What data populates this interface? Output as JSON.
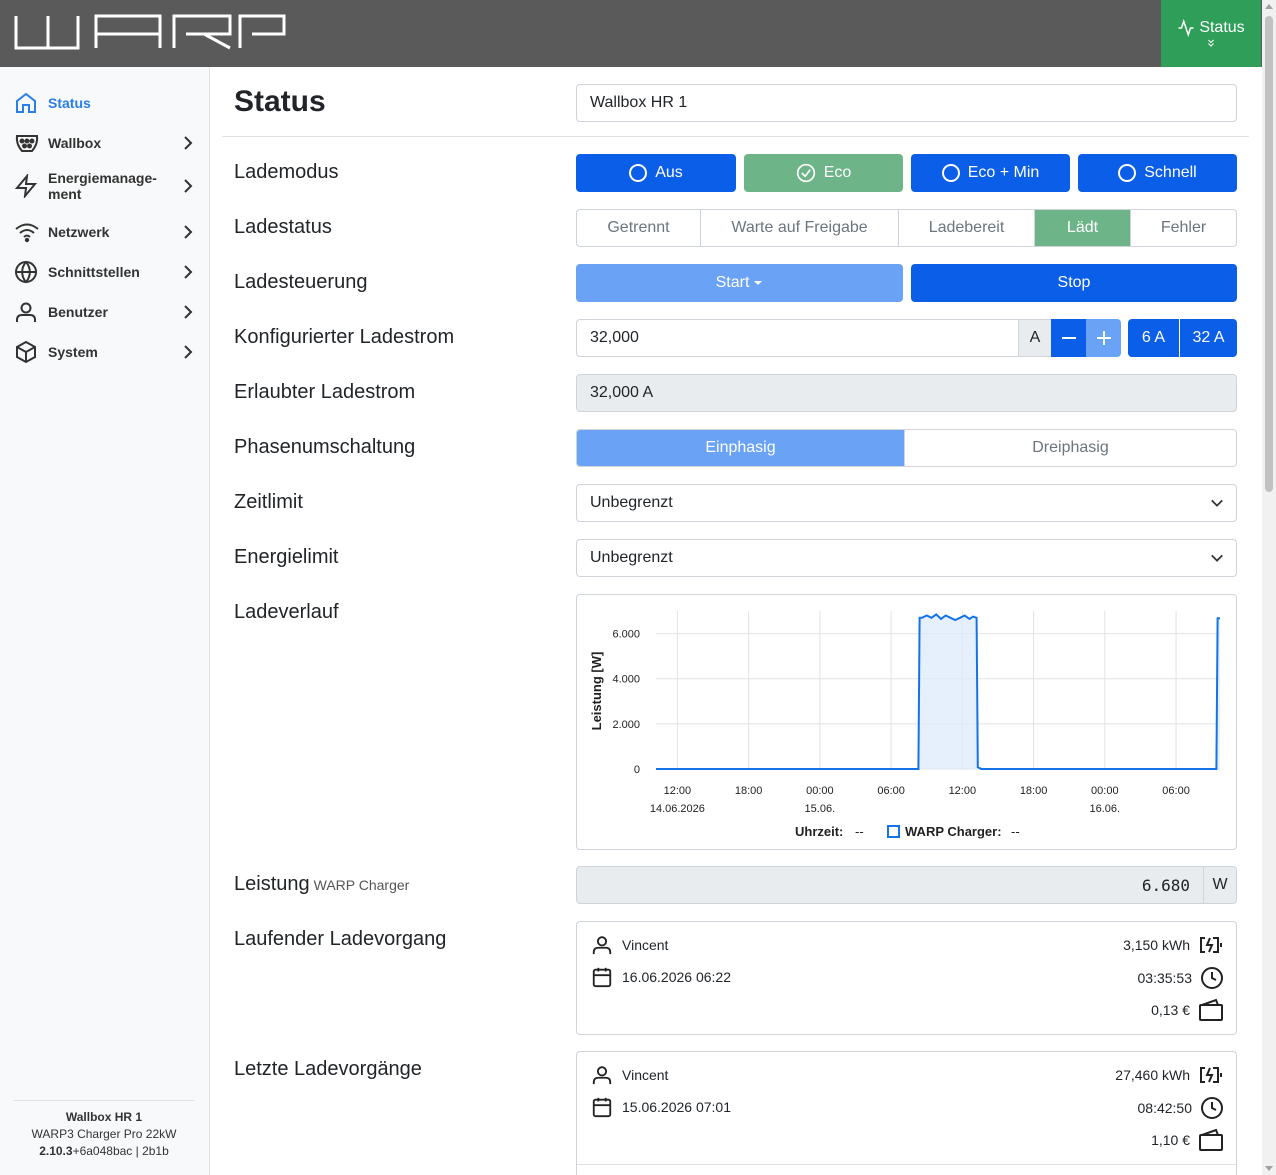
{
  "header": {
    "logo_text": "WARP",
    "status_button": "Status"
  },
  "sidebar": {
    "items": [
      {
        "label": "Status",
        "icon": "home-icon",
        "active": true
      },
      {
        "label": "Wallbox",
        "icon": "charger-plug-icon"
      },
      {
        "label": "Energiemanage-ment",
        "line1": "Energiemanage-",
        "line2": "ment",
        "icon": "lightning-icon"
      },
      {
        "label": "Netzwerk",
        "icon": "wifi-icon"
      },
      {
        "label": "Schnittstellen",
        "icon": "globe-icon"
      },
      {
        "label": "Benutzer",
        "icon": "user-icon"
      },
      {
        "label": "System",
        "icon": "box-icon"
      }
    ],
    "footer": {
      "device_name": "Wallbox HR 1",
      "model": "WARP3 Charger Pro 22kW",
      "version": "2.10.3",
      "build": "+6a048bac | 2b1b"
    }
  },
  "main": {
    "title": "Status",
    "device_name_value": "Wallbox HR 1",
    "rows": {
      "lademodus": "Lademodus",
      "ladestatus": "Ladestatus",
      "ladesteuerung": "Ladesteuerung",
      "konfig_strom": "Konfigurierter Ladestrom",
      "erlaubt_strom": "Erlaubter Ladestrom",
      "phasen": "Phasenumschaltung",
      "zeitlimit": "Zeitlimit",
      "energielimit": "Energielimit",
      "ladeverlauf": "Ladeverlauf",
      "leistung": "Leistung",
      "leistung_sub": "WARP Charger",
      "laufend": "Laufender Ladevorgang",
      "letzte": "Letzte Ladevorgänge"
    },
    "modes": [
      "Aus",
      "Eco",
      "Eco + Min",
      "Schnell"
    ],
    "active_mode": "Eco",
    "states": [
      "Getrennt",
      "Warte auf Freigabe",
      "Ladebereit",
      "Lädt",
      "Fehler"
    ],
    "active_state": "Lädt",
    "start_label": "Start",
    "stop_label": "Stop",
    "configured_current": "32,000",
    "unit_a": "A",
    "preset_min": "6 A",
    "preset_max": "32 A",
    "allowed_current": "32,000 A",
    "phases": [
      "Einphasig",
      "Dreiphasig"
    ],
    "active_phase": "Einphasig",
    "time_limit": "Unbegrenzt",
    "energy_limit": "Unbegrenzt",
    "power_value": "6.680",
    "power_unit": "W",
    "current_session": {
      "user": "Vincent",
      "start": "16.06.2026 06:22",
      "energy": "3,150 kWh",
      "duration": "03:35:53",
      "cost": "0,13 €"
    },
    "last_session": {
      "user": "Vincent",
      "start": "15.06.2026 07:01",
      "energy": "27,460 kWh",
      "duration": "08:42:50",
      "cost": "1,10 €"
    }
  },
  "chart_data": {
    "type": "area",
    "ylabel": "Leistung [W]",
    "ylim": [
      0,
      7000
    ],
    "yticks": [
      "0",
      "2.000",
      "4.000",
      "6.000"
    ],
    "yticks_values": [
      0,
      2000,
      4000,
      6000
    ],
    "xticks": [
      {
        "time": "12:00",
        "date": "14.06.2026",
        "h": 0
      },
      {
        "time": "18:00",
        "date": "",
        "h": 6
      },
      {
        "time": "00:00",
        "date": "15.06.",
        "h": 12
      },
      {
        "time": "06:00",
        "date": "",
        "h": 18
      },
      {
        "time": "12:00",
        "date": "",
        "h": 24
      },
      {
        "time": "18:00",
        "date": "",
        "h": 30
      },
      {
        "time": "00:00",
        "date": "16.06.",
        "h": 36
      },
      {
        "time": "06:00",
        "date": "",
        "h": 42
      }
    ],
    "xlim_hours": [
      -1.8,
      45.7
    ],
    "series": [
      {
        "name": "WARP Charger",
        "points_hours": [
          -1.8,
          20.3,
          20.4,
          20.6,
          21.0,
          21.4,
          21.8,
          22.2,
          22.6,
          23.0,
          23.4,
          23.8,
          24.2,
          24.6,
          24.9,
          25.2,
          25.3,
          25.6,
          45.4,
          45.5,
          45.7
        ],
        "values": [
          0,
          0,
          6700,
          6700,
          6800,
          6700,
          6850,
          6650,
          6800,
          6700,
          6600,
          6700,
          6800,
          6650,
          6750,
          6700,
          80,
          0,
          0,
          6680,
          6680
        ]
      }
    ],
    "legend": {
      "time_label": "Uhrzeit:",
      "time_value": "--",
      "series_label": "WARP Charger:",
      "series_value": "--"
    }
  }
}
